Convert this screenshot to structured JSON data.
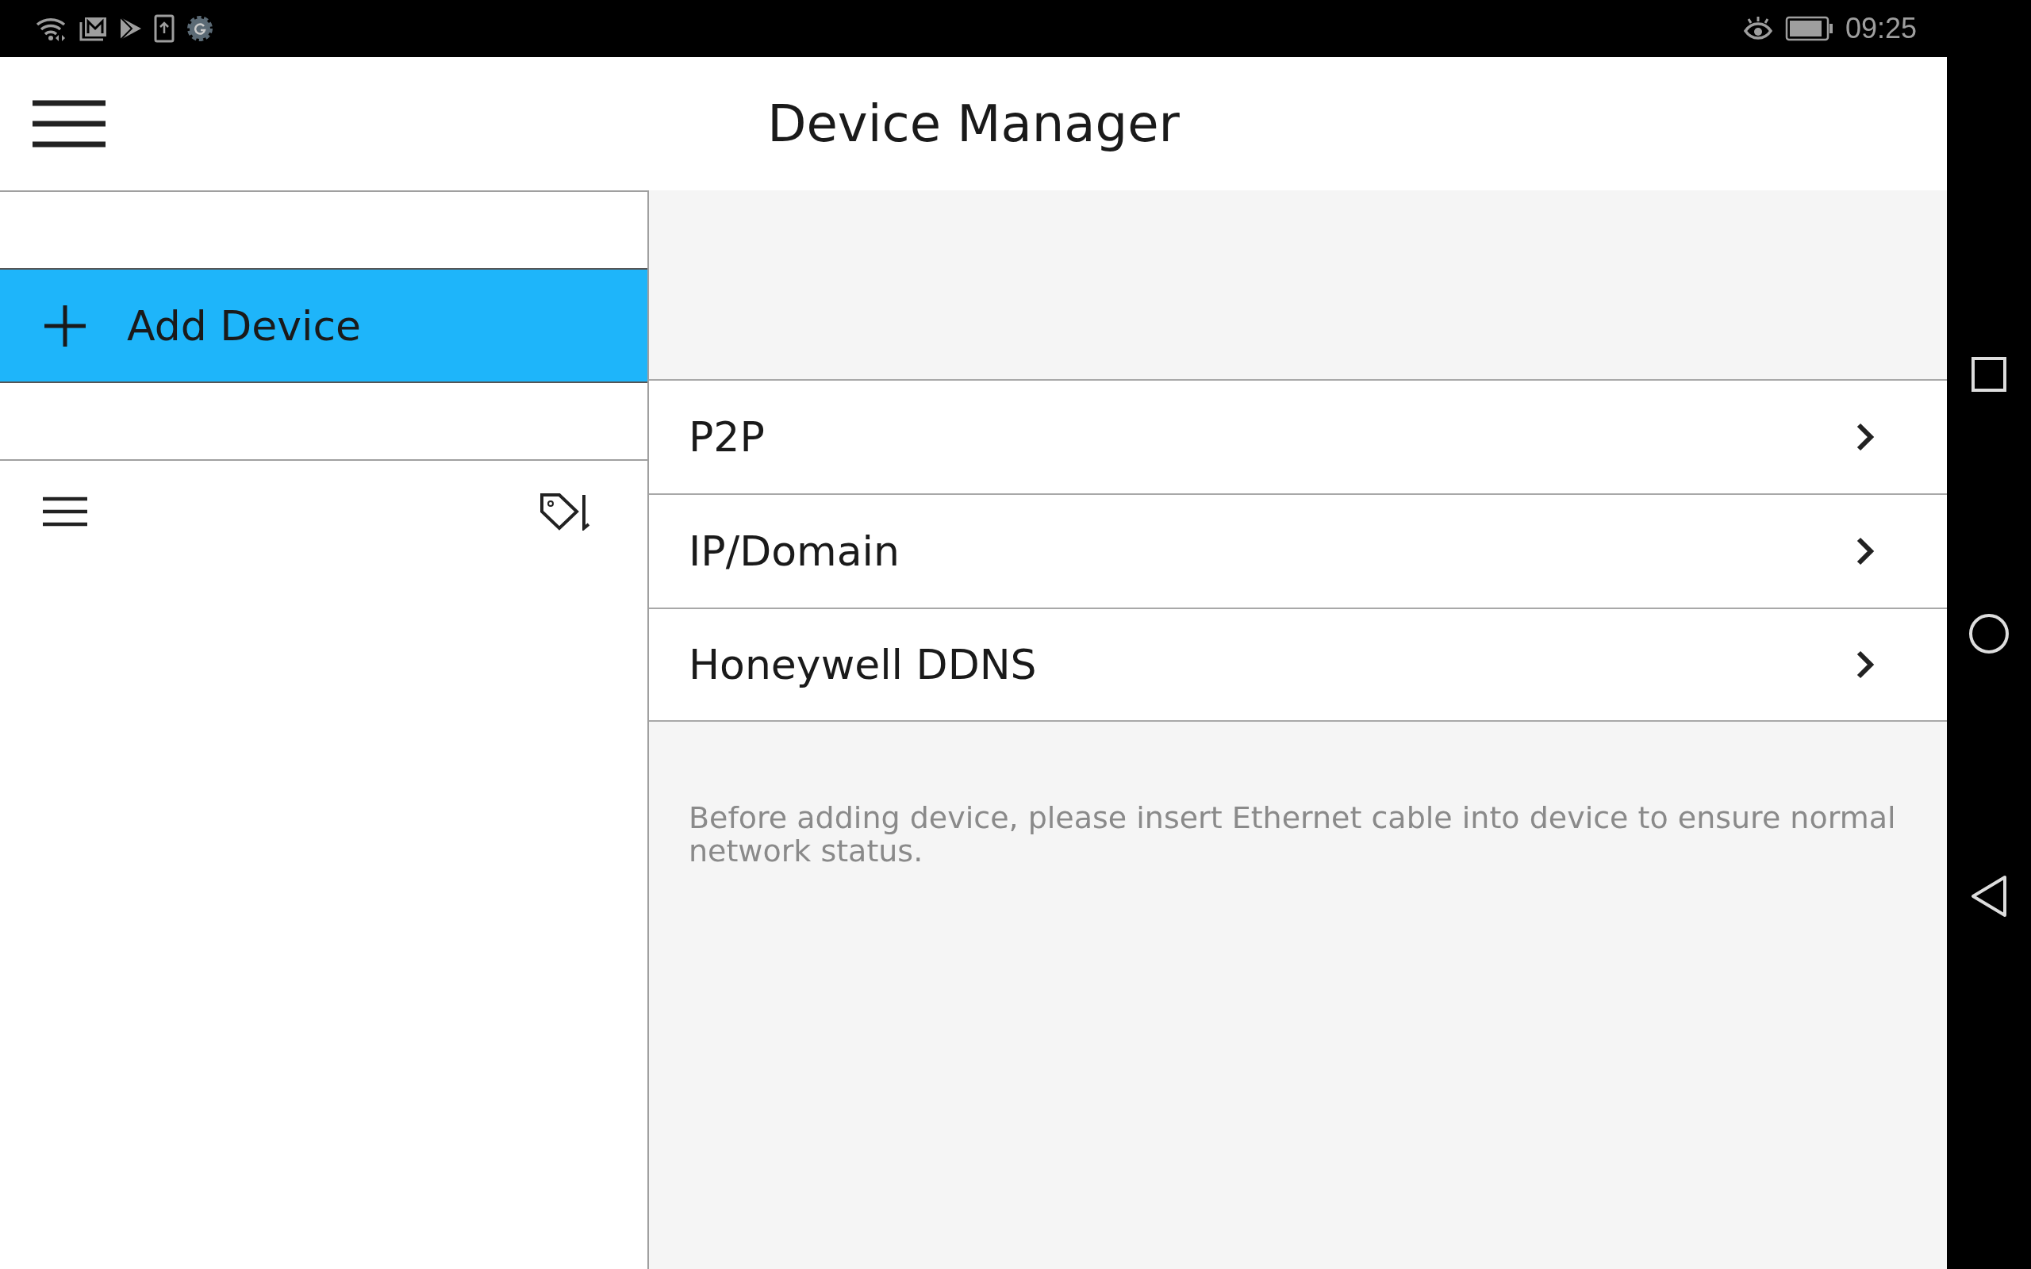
{
  "status_bar": {
    "time": "09:25"
  },
  "header": {
    "title": "Device Manager"
  },
  "sidebar": {
    "add_button": {
      "label": "Add Device"
    }
  },
  "methods": [
    {
      "label": "P2P"
    },
    {
      "label": "IP/Domain"
    },
    {
      "label": "Honeywell DDNS"
    }
  ],
  "note": "Before adding device, please insert Ethernet cable into device to ensure normal network status."
}
